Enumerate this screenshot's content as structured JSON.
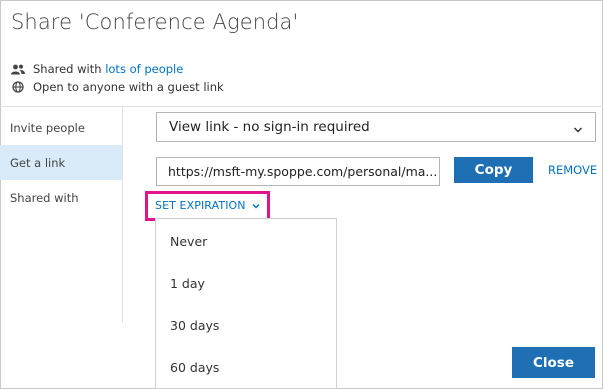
{
  "dialog": {
    "title": "Share 'Conference Agenda'",
    "close_symbol": "✕"
  },
  "info": {
    "shared_prefix": "Shared with ",
    "shared_link": "lots of people",
    "guest_text": "Open to anyone with a guest link"
  },
  "sidebar": {
    "items": [
      {
        "label": "Invite people",
        "active": false
      },
      {
        "label": "Get a link",
        "active": true
      },
      {
        "label": "Shared with",
        "active": false
      }
    ]
  },
  "link_type": {
    "selected": "View link - no sign-in required"
  },
  "link": {
    "url": "https://msft-my.spoppe.com/personal/ma...",
    "copy_label": "Copy",
    "remove_label": "REMOVE"
  },
  "expiration": {
    "label": "SET EXPIRATION",
    "options": [
      "Never",
      "1 day",
      "30 days",
      "60 days"
    ]
  },
  "footer": {
    "close_label": "Close"
  },
  "colors": {
    "accent": "#1f6fb5",
    "link": "#0072c6",
    "highlight": "#e3138b",
    "sidebar_active": "#d9ebf9"
  },
  "icons": {
    "people": "people-icon",
    "globe": "globe-icon",
    "chevron": "chevron-down-icon"
  }
}
